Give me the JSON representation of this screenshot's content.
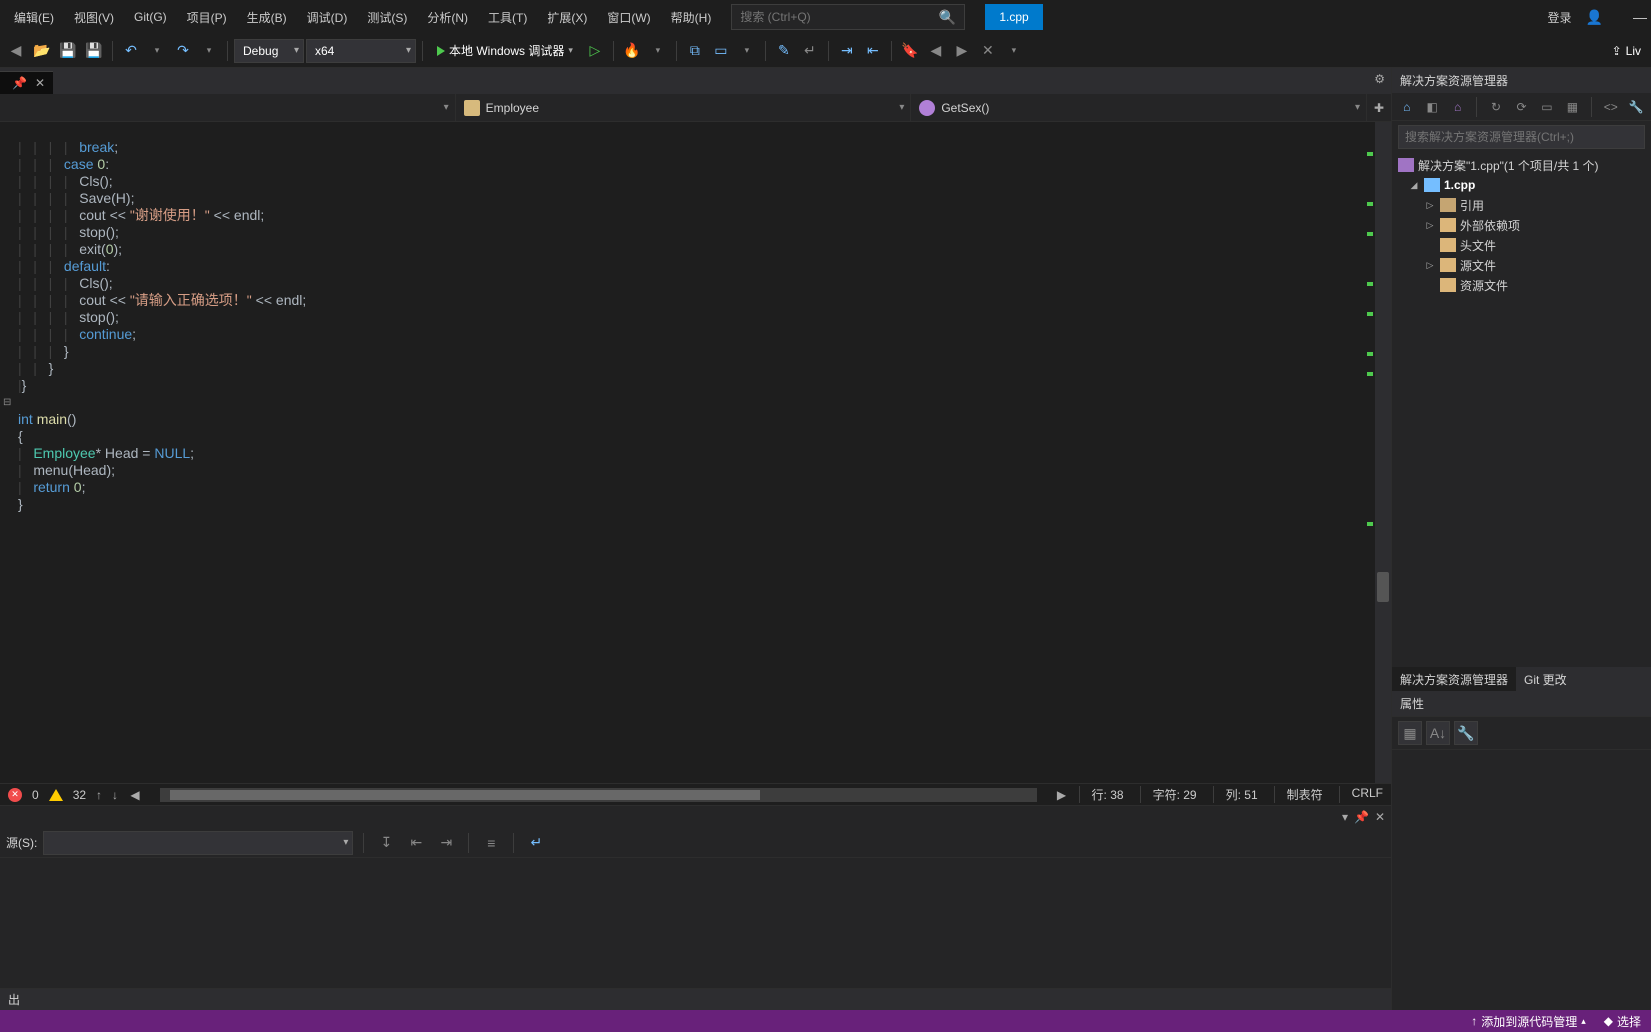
{
  "menu": [
    "编辑(E)",
    "视图(V)",
    "Git(G)",
    "项目(P)",
    "生成(B)",
    "调试(D)",
    "测试(S)",
    "分析(N)",
    "工具(T)",
    "扩展(X)",
    "窗口(W)",
    "帮助(H)"
  ],
  "search": {
    "placeholder": "搜索 (Ctrl+Q)"
  },
  "active_doc": "1.cpp",
  "login": "登录",
  "live": "Liv",
  "toolbar": {
    "config": "Debug",
    "platform": "x64",
    "debugger": "本地 Windows 调试器"
  },
  "tab": {
    "name": "",
    "close": "✕"
  },
  "nav": {
    "class": "Employee",
    "method": "GetSex()"
  },
  "code_lines": [
    {
      "i": 14,
      "t": "                break;",
      "cls": "kw-break"
    },
    {
      "i": 14,
      "t": "            case 0:",
      "cls": "kw-case"
    },
    {
      "i": 18,
      "t": "                Cls();"
    },
    {
      "i": 18,
      "t": "                Save(H);"
    },
    {
      "i": 18,
      "t": "                cout << \"谢谢使用！\" << endl;"
    },
    {
      "i": 18,
      "t": "                stop();"
    },
    {
      "i": 18,
      "t": "                exit(0);"
    },
    {
      "i": 14,
      "t": "            default:",
      "cls": "kw-default"
    },
    {
      "i": 18,
      "t": "                Cls();"
    },
    {
      "i": 18,
      "t": "                cout << \"请输入正确选项！\" << endl;"
    },
    {
      "i": 18,
      "t": "                stop();"
    },
    {
      "i": 18,
      "t": "                continue;",
      "cls": "kw-cont"
    },
    {
      "i": 14,
      "t": "            }"
    },
    {
      "i": 10,
      "t": "        }"
    },
    {
      "i": 4,
      "t": "}"
    },
    {
      "i": 0,
      "t": ""
    },
    {
      "i": 0,
      "t": "int main()",
      "cls": "func"
    },
    {
      "i": 0,
      "t": "{"
    },
    {
      "i": 4,
      "t": "    Employee* Head = NULL;"
    },
    {
      "i": 4,
      "t": "    menu(Head);"
    },
    {
      "i": 4,
      "t": "    return 0;"
    },
    {
      "i": 0,
      "t": "}"
    }
  ],
  "editor_status": {
    "errors": "0",
    "warnings": "32",
    "line": "行: 38",
    "char": "字符: 29",
    "col": "列: 51",
    "tabs": "制表符",
    "eol": "CRLF"
  },
  "output": {
    "source_label": "源(S):",
    "tab": "出"
  },
  "solution": {
    "title": "解决方案资源管理器",
    "search_placeholder": "搜索解决方案资源管理器(Ctrl+;)",
    "root": "解决方案\"1.cpp\"(1 个项目/共 1 个)",
    "project": "1.cpp",
    "nodes": [
      "引用",
      "外部依赖项",
      "头文件",
      "源文件",
      "资源文件"
    ],
    "tabs": [
      "解决方案资源管理器",
      "Git 更改"
    ]
  },
  "properties": {
    "title": "属性"
  },
  "statusbar": {
    "add_source": "添加到源代码管理",
    "select": "选择"
  }
}
